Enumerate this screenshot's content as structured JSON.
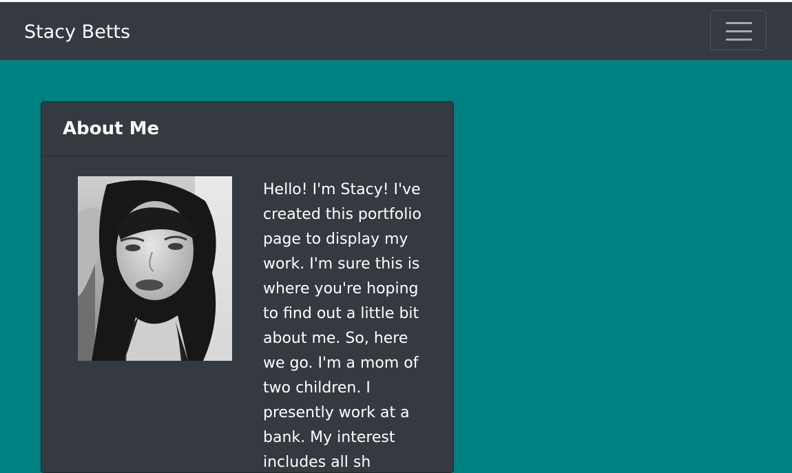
{
  "navbar": {
    "brand": "Stacy Betts",
    "toggler_icon": "hamburger-menu-icon"
  },
  "about": {
    "title": "About Me",
    "photo_alt": "Stacy Betts portrait",
    "bio": "Hello! I'm Stacy! I've created this portfolio page to display my work. I'm sure this is where you're hoping to find out a little bit about me. So, here we go. I'm a mom of two children. I presently work at a bank. My interest includes all sh"
  },
  "colors": {
    "page_background": "#008080",
    "navbar_background": "#343a40",
    "card_background": "#343a40",
    "text": "#ffffff"
  }
}
